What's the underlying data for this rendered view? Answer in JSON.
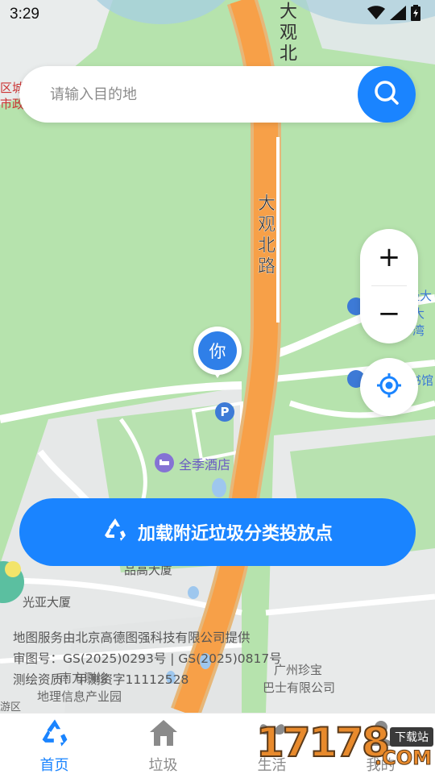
{
  "status_bar": {
    "time": "3:29",
    "icons": [
      "wifi-icon",
      "signal-icon",
      "battery-icon"
    ]
  },
  "search": {
    "placeholder": "请输入目的地",
    "value": "",
    "button_icon": "search-icon"
  },
  "map": {
    "labels": {
      "road_main": "大观北路",
      "road_top": "大观北",
      "hotel": "全季酒店",
      "building_1": "品高大厦",
      "building_2": "光亚大厦",
      "poi_right_1": "经大",
      "poi_right_2": "大湾",
      "poi_right_3": "书馆",
      "left_top_1": "区城",
      "left_top_2": "市政",
      "bottom_1": "南方测绘",
      "bottom_2": "地理信息产业园",
      "bottom_3": "广州珍宝",
      "bottom_4": "巴士有限公司",
      "bottom_left": "游区"
    },
    "user_marker": "你",
    "parking_icon": "P",
    "copyright": [
      "地图服务由北京高德图强科技有限公司提供",
      "审图号：GS(2025)0293号 | GS(2025)0817号",
      "测绘资质：甲测资字11112528"
    ]
  },
  "controls": {
    "zoom_in": "+",
    "zoom_out": "−",
    "locate_icon": "locate-icon"
  },
  "load_button": {
    "label": "加载附近垃圾分类投放点",
    "icon": "recycle-icon"
  },
  "tabs": [
    {
      "label": "首页",
      "icon": "recycle-icon",
      "active": true
    },
    {
      "label": "垃圾",
      "icon": "home-icon",
      "active": false
    },
    {
      "label": "生活",
      "icon": "butterfly-icon",
      "active": false
    },
    {
      "label": "我的",
      "icon": "person-icon",
      "active": false
    }
  ],
  "watermark": {
    "number": "17178",
    "tag": "下载站",
    "suffix": ".COM"
  },
  "colors": {
    "accent": "#1a84ff",
    "map_green": "#b6e3ad",
    "road_orange": "#f7a048",
    "marker_blue": "#2f7fe8"
  }
}
